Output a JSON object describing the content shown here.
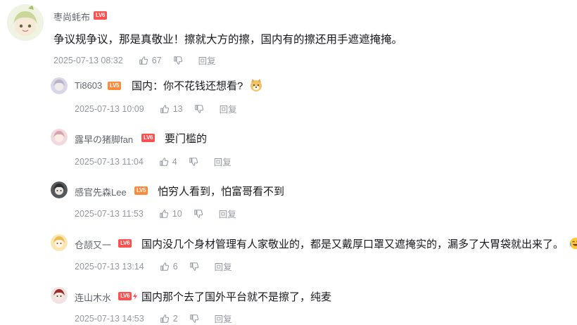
{
  "main_comment": {
    "username": "枣尚蚝布",
    "level": "LV6",
    "text": "争议规争议，那是真敬业！擦就大方的擦，国内有的擦还用手遮遮掩掩。",
    "time": "2025-07-13 08:32",
    "likes": "67",
    "reply_label": "回复"
  },
  "replies": [
    {
      "username": "Ti8603",
      "level": "LV5",
      "text": "国内：你不花钱还想看?",
      "emoji": "doge-emoji",
      "time": "2025-07-13 10:09",
      "likes": "13",
      "reply_label": "回复"
    },
    {
      "username": "露早の猪脚fan",
      "level": "LV6",
      "text": "要门槛的",
      "time": "2025-07-13 11:04",
      "likes": "4",
      "reply_label": "回复"
    },
    {
      "username": "感官先森Lee",
      "level": "LV5",
      "text": "怕穷人看到，怕富哥看不到",
      "time": "2025-07-13 11:53",
      "likes": "10",
      "reply_label": "回复"
    },
    {
      "username": "仓颉又一",
      "level": "LV6",
      "text": "国内没几个身材管理有人家敬业的，都是又戴厚口罩又遮掩实的，漏多了大胃袋就出来了。",
      "emoji": "laughing-crying-emoji",
      "time": "2025-07-13 13:14",
      "likes": "6",
      "reply_label": "回复"
    },
    {
      "username": "连山木水",
      "level": "LV6",
      "text": "国内那个去了国外平台就不是擦了，纯麦",
      "time": "2025-07-13 14:53",
      "likes": "2",
      "reply_label": "回复"
    }
  ],
  "colors": {
    "username": "#61666d",
    "meta": "#9499a0",
    "level6": "#ff4f4f",
    "level5": "#ff8a3d"
  }
}
